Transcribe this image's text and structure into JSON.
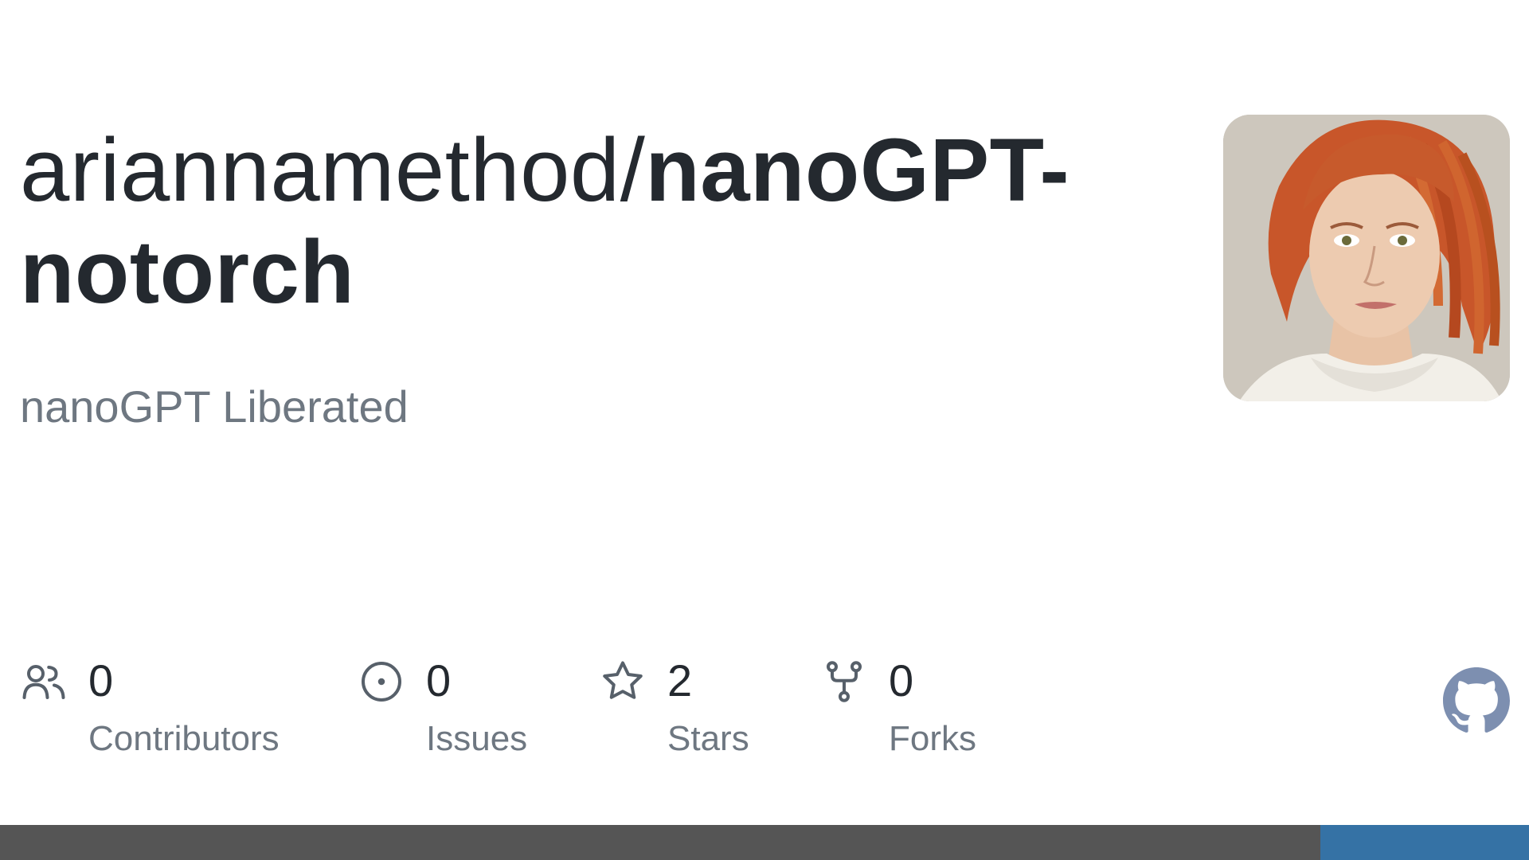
{
  "repo": {
    "owner": "ariannamethod/",
    "name": "nanoGPT-notorch",
    "description": "nanoGPT Liberated"
  },
  "stats": [
    {
      "icon": "people-icon",
      "count": "0",
      "label": "Contributors"
    },
    {
      "icon": "issue-icon",
      "count": "0",
      "label": "Issues"
    },
    {
      "icon": "star-icon",
      "count": "2",
      "label": "Stars"
    },
    {
      "icon": "fork-icon",
      "count": "0",
      "label": "Forks"
    }
  ],
  "colors": {
    "title": "#24292f",
    "muted": "#6e7781",
    "icon": "#57606a",
    "github_mark": "#7d8fb0",
    "language_bar": [
      "#555555",
      "#3572a5"
    ]
  },
  "language_bar": [
    {
      "fraction": 0.864
    },
    {
      "fraction": 0.136
    }
  ],
  "brand_icon": "github-mark-icon",
  "avatar_icon": "owner-avatar"
}
